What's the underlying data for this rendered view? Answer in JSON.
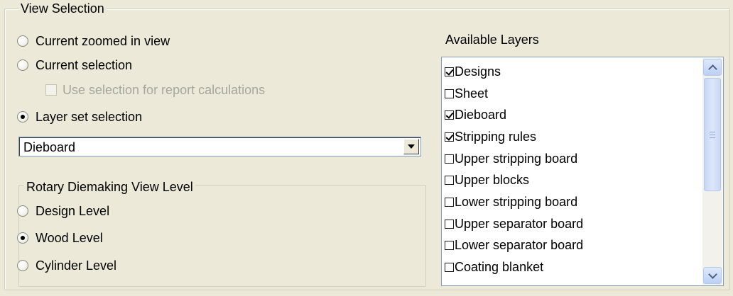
{
  "view_selection": {
    "title": "View Selection",
    "options": [
      {
        "label": "Current zoomed in view",
        "selected": false
      },
      {
        "label": "Current selection",
        "selected": false
      },
      {
        "label": "Layer set selection",
        "selected": true
      }
    ],
    "use_selection_label": "Use selection for report calculations",
    "use_selection_checked": false,
    "use_selection_enabled": false,
    "layer_set_value": "Dieboard"
  },
  "rotary": {
    "title": "Rotary Diemaking View Level",
    "options": [
      {
        "label": "Design Level",
        "selected": false
      },
      {
        "label": "Wood Level",
        "selected": true
      },
      {
        "label": "Cylinder Level",
        "selected": false
      }
    ]
  },
  "layers": {
    "title": "Available Layers",
    "items": [
      {
        "label": "Designs",
        "checked": true
      },
      {
        "label": "Sheet",
        "checked": false
      },
      {
        "label": "Dieboard",
        "checked": true
      },
      {
        "label": "Stripping rules",
        "checked": true
      },
      {
        "label": "Upper stripping board",
        "checked": false
      },
      {
        "label": "Upper blocks",
        "checked": false
      },
      {
        "label": "Lower stripping board",
        "checked": false
      },
      {
        "label": "Upper separator board",
        "checked": false
      },
      {
        "label": "Lower separator board",
        "checked": false
      },
      {
        "label": "Coating blanket",
        "checked": false
      }
    ]
  }
}
